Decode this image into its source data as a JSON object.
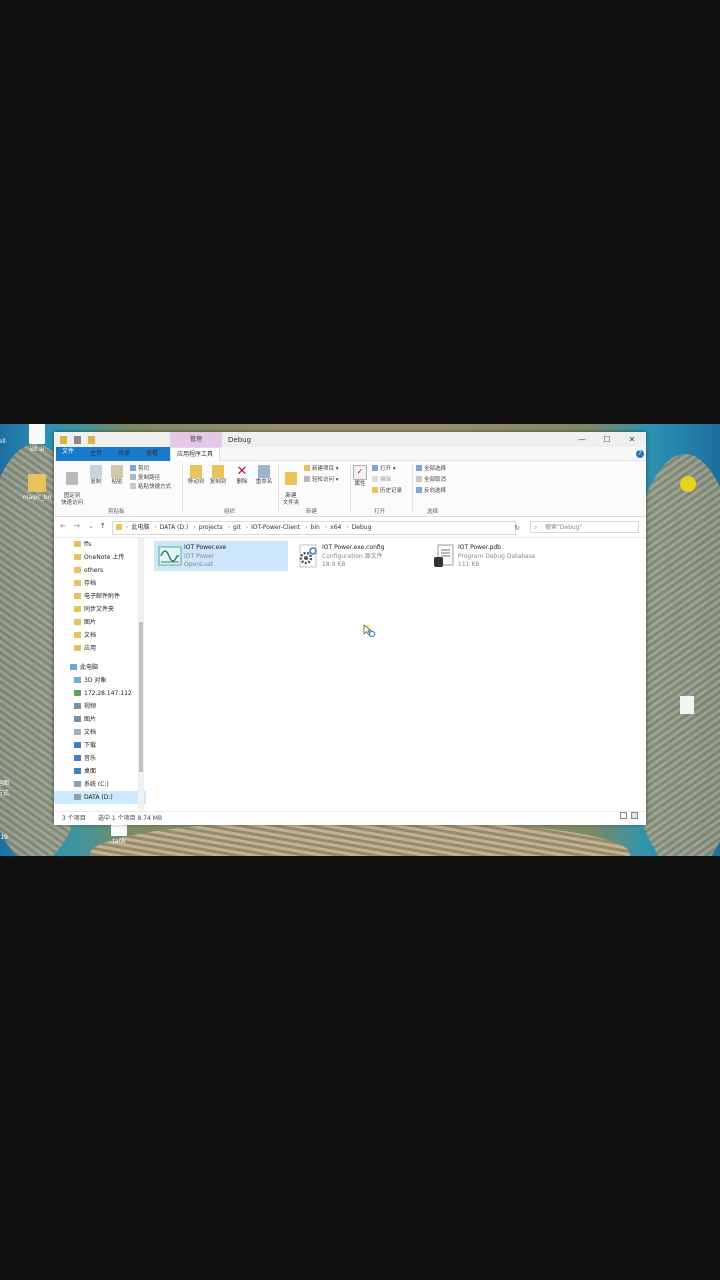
{
  "desktop": {
    "icons": [
      "iot.ai",
      "magic_bo",
      "tank"
    ],
    "side_labels": [
      "rell",
      "运图",
      "方式",
      "t19"
    ]
  },
  "window": {
    "context_tab": "管理",
    "title": "Debug",
    "controls": {
      "minimize": "—",
      "maximize": "☐",
      "close": "✕"
    }
  },
  "ribbon_tabs": [
    {
      "label": "文件"
    },
    {
      "label": "主页"
    },
    {
      "label": "共享"
    },
    {
      "label": "查看"
    },
    {
      "label": "应用程序工具"
    }
  ],
  "ribbon": {
    "clipboard": {
      "pin": "固定到\n快速访问",
      "copy": "复制",
      "paste": "粘贴",
      "cut": "剪切",
      "copy_path": "复制路径",
      "paste_shortcut": "粘贴快捷方式",
      "group": "剪贴板"
    },
    "organize": {
      "move_to": "移动到",
      "copy_to": "复制到",
      "delete": "删除",
      "rename": "重命名",
      "group": "组织"
    },
    "new": {
      "new_folder": "新建\n文件夹",
      "new_item": "新建项目 ▾",
      "easy_access": "轻松访问 ▾",
      "group": "新建"
    },
    "open": {
      "properties": "属性",
      "open": "打开 ▾",
      "edit": "编辑",
      "history": "历史记录",
      "group": "打开"
    },
    "select": {
      "select_all": "全部选择",
      "select_none": "全部取消",
      "invert": "反向选择",
      "group": "选择"
    }
  },
  "address": {
    "back": "←",
    "forward": "→",
    "recent": "⌄",
    "up": "↑",
    "crumbs": [
      "此电脑",
      "DATA (D:)",
      "projects",
      "git",
      "IOT-Power-Client",
      "bin",
      "x64",
      "Debug"
    ],
    "refresh": "↻",
    "search_placeholder": "搜索\"Debug\""
  },
  "nav_items": [
    {
      "label": "ffs"
    },
    {
      "label": "OneNote 上传"
    },
    {
      "label": "others"
    },
    {
      "label": "存档"
    },
    {
      "label": "电子邮件附件"
    },
    {
      "label": "同步文件夹"
    },
    {
      "label": "图片"
    },
    {
      "label": "文档"
    },
    {
      "label": "应用"
    },
    {
      "label": "此电脑"
    },
    {
      "label": "3D 对象"
    },
    {
      "label": "172.28.147.112"
    },
    {
      "label": "视频"
    },
    {
      "label": "图片"
    },
    {
      "label": "文档"
    },
    {
      "label": "下载"
    },
    {
      "label": "音乐"
    },
    {
      "label": "桌面"
    },
    {
      "label": "系统 (C:)"
    },
    {
      "label": "DATA (D:)"
    }
  ],
  "files": [
    {
      "name": "IOT Power.exe",
      "line2": "IOT Power",
      "line3": "OpenLuat",
      "selected": true
    },
    {
      "name": "IOT Power.exe.config",
      "line2": "Configuration 源文件",
      "line3": "18.9 KB",
      "selected": false
    },
    {
      "name": "IOT Power.pdb",
      "line2": "Program Debug Database",
      "line3": "111 KB",
      "selected": false
    }
  ],
  "status": {
    "count": "3 个项目",
    "selection": "选中 1 个项目  8.74 MB"
  }
}
